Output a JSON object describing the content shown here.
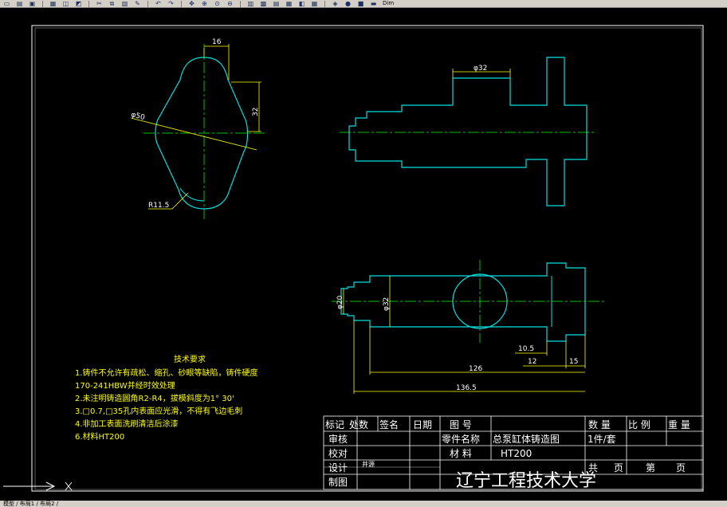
{
  "toolbar": {
    "icons": [
      "new-file",
      "open-file",
      "save",
      "print",
      "preview",
      "plot",
      "cut",
      "copy",
      "paste",
      "match",
      "undo",
      "redo",
      "pan",
      "zoom-realtime",
      "zoom-window",
      "zoom-previous",
      "properties",
      "design-center",
      "tool-palettes",
      "sheet-set",
      "markup",
      "calculator",
      "layer",
      "layer-state",
      "color",
      "linetype"
    ],
    "dim_label": "Dim"
  },
  "drawing": {
    "front_view": {
      "dim_16": "16",
      "dim_32": "32",
      "dim_phi50": "φ50",
      "dim_r115": "R11.5"
    },
    "side_view": {
      "dim_phi32": "φ32"
    },
    "bottom_view": {
      "dim_phi20": "φ20",
      "dim_phi32": "φ32",
      "dim_105": "10.5",
      "dim_12": "12",
      "dim_15": "15",
      "dim_126": "126",
      "dim_1365": "136.5"
    },
    "tech_requirements": {
      "title": "技术要求",
      "lines": [
        "1.铸件不允许有疏松、缩孔、砂眼等缺陷，铸件硬度",
        "170-241HBW并经时效处理",
        "2.未注明铸造圆角R2-R4，拔模斜度为1° 30'",
        "3.□0.7,□35孔内表面应光滑，不得有飞边毛刺",
        "4.非加工表面洗刷清洁后涂漆",
        "6.材料HT200"
      ]
    },
    "title_block": {
      "h_marker": "标记",
      "h_count": "处数",
      "h_sign": "签名",
      "h_date": "日期",
      "h_drawing_no": "图 号",
      "h_quantity": "数 量",
      "h_ratio": "比 例",
      "h_weight": "重 量",
      "lbl_review": "审核",
      "lbl_proofread": "校对",
      "lbl_design": "设计",
      "lbl_draft": "制图",
      "designer_name": "井源",
      "lbl_part_name": "零件名称",
      "part_name": "总泵缸体铸造图",
      "pieces": "1件/套",
      "lbl_material": "材 料",
      "material": "HT200",
      "lbl_total": "共",
      "lbl_page1": "页",
      "lbl_nth": "第",
      "lbl_page2": "页",
      "school": "辽宁工程技术大学"
    }
  },
  "statusbar": {
    "text": "模型 / 布局1 / 布局2 /"
  },
  "colors": {
    "background": "#000000",
    "outline": "#00e0e0",
    "centerline": "#00c000",
    "dimension": "#ffff00",
    "frame": "#ffffff"
  }
}
